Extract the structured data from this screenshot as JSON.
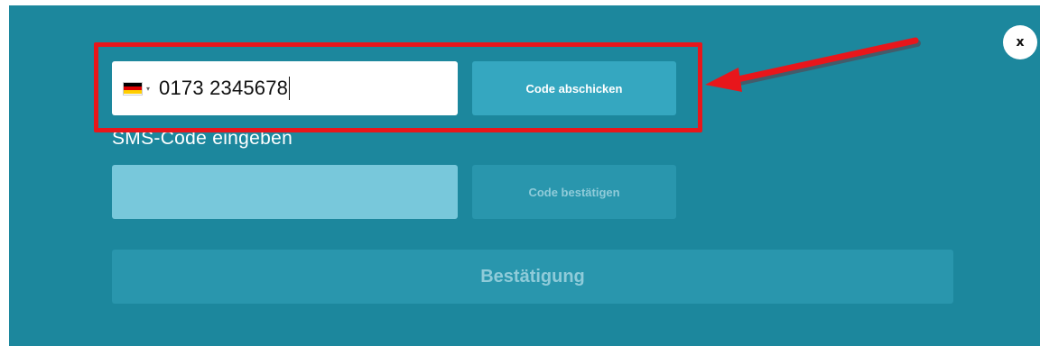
{
  "dialog": {
    "close_label": "x"
  },
  "phone": {
    "country_flag": "de-flag-icon",
    "flag_colors": [
      "#000000",
      "#dd0000",
      "#ffce00"
    ],
    "value": "0173 2345678"
  },
  "buttons": {
    "send_code_label": "Code abschicken",
    "confirm_code_label": "Code bestätigen",
    "confirmation_label": "Bestätigung"
  },
  "sms": {
    "label": "SMS-Code eingeben",
    "value": ""
  },
  "annotation": {
    "highlight_color": "#e8161b"
  },
  "colors": {
    "panel_background": "#1c879d",
    "active_button": "#35a7c0",
    "disabled_button": "#2996ad",
    "sms_field": "#78c8db"
  }
}
